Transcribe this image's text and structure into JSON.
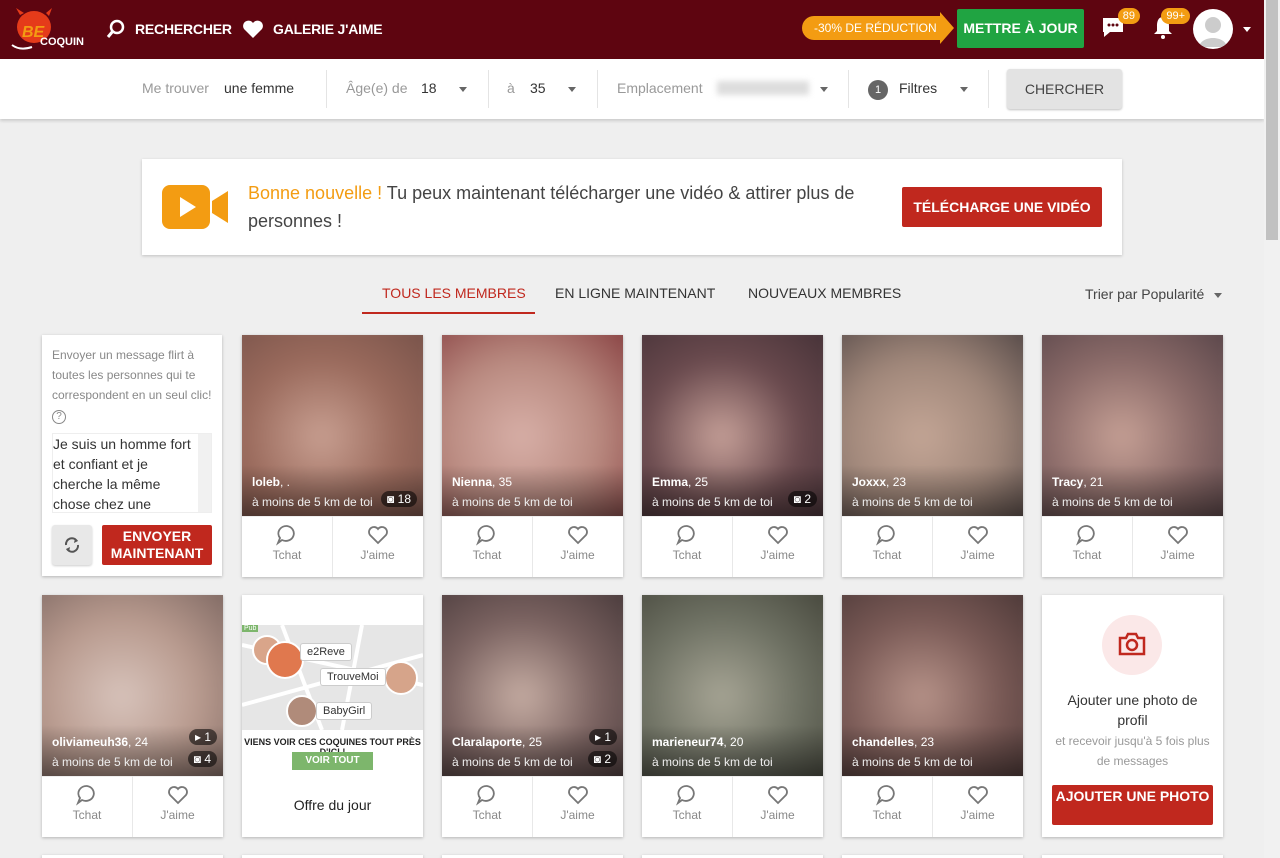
{
  "header": {
    "logo_text": "BE coquin",
    "search_label": "RECHERCHER",
    "gallery_label": "GALERIE J'AIME",
    "promo_label": "-30% DE RÉDUCTION",
    "upgrade_label": "METTRE À JOUR",
    "messages_count": "89",
    "notifications_count": "99+"
  },
  "filters": {
    "find_label": "Me trouver",
    "find_value": "une femme",
    "age_label": "Âge(e) de",
    "age_from": "18",
    "age_to_label": "à",
    "age_to": "35",
    "location_label": "Emplacement",
    "filters_count": "1",
    "filters_label": "Filtres",
    "search_button": "CHERCHER"
  },
  "banner": {
    "highlight": "Bonne nouvelle !",
    "text": " Tu peux maintenant télécharger une vidéo & attirer plus de personnes !",
    "button": "TÉLÉCHARGE UNE VIDÉO"
  },
  "tabs": [
    {
      "label": "TOUS LES MEMBRES"
    },
    {
      "label": "EN LIGNE MAINTENANT"
    },
    {
      "label": "NOUVEAUX MEMBRES"
    }
  ],
  "sort_label": "Trier par Popularité",
  "flirt": {
    "text": "Envoyer un message flirt à toutes les personnes qui te correspondent en un seul clic!",
    "message": "Je suis un homme fort et confiant et je cherche la même chose chez une",
    "send_button": "ENVOYER MAINTENANT"
  },
  "actions": {
    "chat": "Tchat",
    "like": "J'aime"
  },
  "members": [
    {
      "name": "loleb",
      "age": ", .",
      "distance": "à moins de 5 km de toi",
      "photos": "18"
    },
    {
      "name": "Nienna",
      "age": ", 35",
      "distance": "à moins de 5 km de toi",
      "photos": ""
    },
    {
      "name": "Emma",
      "age": ", 25",
      "distance": "à moins de 5 km de toi",
      "photos": "2"
    },
    {
      "name": "Joxxx",
      "age": ", 23",
      "distance": "à moins de 5 km de toi",
      "photos": ""
    },
    {
      "name": "Tracy",
      "age": ", 21",
      "distance": "à moins de 5 km de toi",
      "photos": ""
    },
    {
      "name": "oliviameuh36",
      "age": ", 24",
      "distance": "à moins de 5 km de toi",
      "videos": "1",
      "photos": "4"
    },
    {
      "name": "Claralaporte",
      "age": ", 25",
      "distance": "à moins de 5 km de toi",
      "videos": "1",
      "photos": "2"
    },
    {
      "name": "marieneur74",
      "age": ", 20",
      "distance": "à moins de 5 km de toi",
      "photos": ""
    },
    {
      "name": "chandelles",
      "age": ", 23",
      "distance": "à moins de 5 km de toi",
      "photos": ""
    }
  ],
  "ad": {
    "pub": "Pub",
    "names": [
      "e2Reve",
      "TrouveMoi",
      "BabyGirl"
    ],
    "title": "VIENS VOIR CES COQUINES TOUT PRÈS D'ICI !",
    "button": "VOIR TOUT",
    "footer": "Offre du jour"
  },
  "add_photo": {
    "title": "Ajouter une photo de profil",
    "subtitle": "et recevoir jusqu'à 5 fois plus de messages",
    "button": "AJOUTER UNE PHOTO"
  }
}
